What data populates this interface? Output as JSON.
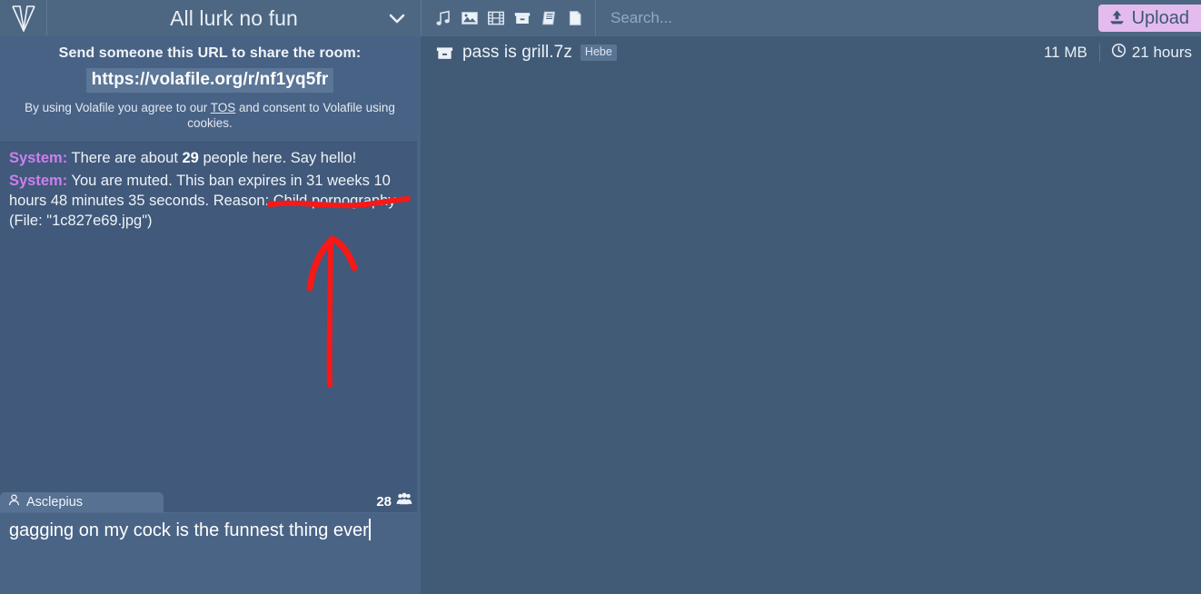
{
  "colors": {
    "topbar_bg": "#4d6783",
    "panel_bg": "#415b77",
    "chat_bg": "#41597a",
    "share_bg": "#486285",
    "accent_upload": "#e3bbee",
    "system_nick": "#cd7ff0",
    "annotation_red": "#f81818",
    "badge_bg": "#5a7494"
  },
  "topbar": {
    "logo": "volafile-v-logo",
    "room_title": "All lurk no fun",
    "room_dropdown_icon": "chevron-down-icon",
    "filters": [
      {
        "name": "music-icon",
        "label": "Music"
      },
      {
        "name": "image-icon",
        "label": "Images"
      },
      {
        "name": "video-icon",
        "label": "Videos"
      },
      {
        "name": "archive-icon",
        "label": "Archives"
      },
      {
        "name": "book-icon",
        "label": "Books"
      },
      {
        "name": "document-icon",
        "label": "Documents"
      }
    ],
    "search": {
      "value": "",
      "placeholder": "Search..."
    },
    "upload": {
      "label": "Upload",
      "icon": "upload-icon"
    }
  },
  "chat": {
    "share": {
      "heading": "Send someone this URL to share the room:",
      "url": "https://volafile.org/r/nf1yq5fr",
      "tos_prefix": "By using Volafile you agree to our ",
      "tos_link": "TOS",
      "tos_suffix": " and consent to Volafile using cookies."
    },
    "messages": [
      {
        "nick": "System:",
        "nick_type": "system",
        "segments": [
          {
            "text": "There are about "
          },
          {
            "text": "29",
            "bold": true
          },
          {
            "text": " people here. Say hello!"
          }
        ],
        "plain": "There are about 29 people here. Say hello!"
      },
      {
        "nick": "System:",
        "nick_type": "system",
        "segments": [
          {
            "text": "You are muted. This ban expires in 31 weeks 10 hours 48 minutes 35 seconds. Reason: Child pornography (File: \"1c827e69.jpg\")"
          }
        ],
        "plain": "You are muted. This ban expires in 31 weeks 10 hours 48 minutes 35 seconds. Reason: Child pornography (File: \"1c827e69.jpg\")"
      }
    ],
    "user_tab": {
      "icon": "user-icon",
      "name": "Asclepius"
    },
    "user_count": {
      "value": "28",
      "icon": "people-group-icon"
    },
    "message_input": {
      "value": "gagging on my cock is the funnest thing ever",
      "placeholder": ""
    }
  },
  "files": {
    "columns": [
      "name",
      "size",
      "time_left"
    ],
    "rows": [
      {
        "icon": "archive-icon",
        "name": "pass is grill.7z",
        "uploader_badge": "Hebe",
        "size": "11 MB",
        "ttl_icon": "clock-icon",
        "ttl": "21 hours"
      }
    ]
  },
  "annotations": {
    "underline": {
      "type": "red-underline",
      "target": "Child pornography"
    },
    "arrow": {
      "type": "red-arrow-up",
      "points_to": "Child pornography"
    }
  }
}
